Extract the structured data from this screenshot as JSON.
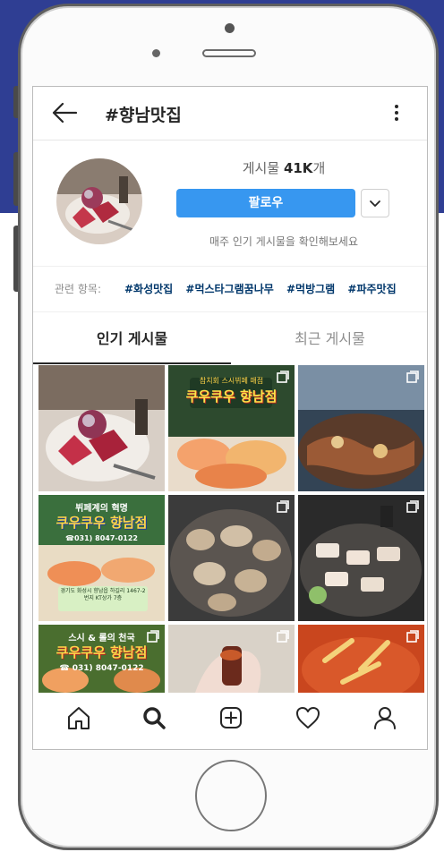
{
  "header": {
    "title": "#향남맛집"
  },
  "profile": {
    "posts_label": "게시물",
    "posts_count": "41K",
    "posts_suffix": "개",
    "follow_label": "팔로우",
    "hint": "매주 인기 게시물을 확인해보세요"
  },
  "related": {
    "label": "관련 항목:",
    "tags": [
      "#화성맛집",
      "#먹스타그램꿈나무",
      "#먹방그램",
      "#파주맛집"
    ]
  },
  "tabs": {
    "top": "인기 게시물",
    "recent": "최근 게시물"
  },
  "posts": [
    {
      "title": "",
      "sub": ""
    },
    {
      "title": "쿠우쿠우 향남점",
      "sub": "참치회 스시뷔페 매점"
    },
    {
      "title": "",
      "sub": ""
    },
    {
      "title": "쿠우쿠우 향남점",
      "sub": "뷔페계의 혁명",
      "phone": "☎031) 8047-0122",
      "addr": "경기도 화성시 향남읍 하길리 1467-2번지 KT상가 7층"
    },
    {
      "title": "",
      "sub": ""
    },
    {
      "title": "",
      "sub": ""
    },
    {
      "title": "쿠우쿠우 향남점",
      "sub": "스시 & 롤의 천국",
      "phone": "☎ 031) 8047-0122"
    }
  ],
  "nav": [
    "home-icon",
    "search-icon",
    "add-post-icon",
    "activity-heart-icon",
    "profile-icon"
  ],
  "colors": {
    "accent": "#3797f0",
    "band": "#2f3e93",
    "text": "#262626",
    "muted": "#8e8e8e",
    "tag": "#00376b"
  }
}
